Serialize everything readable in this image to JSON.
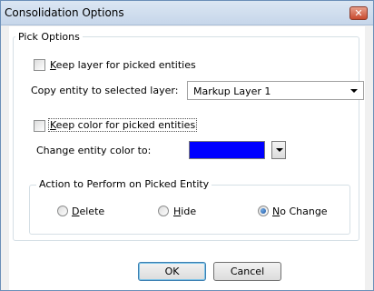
{
  "window": {
    "title": "Consolidation Options",
    "close_glyph": "✕"
  },
  "pick_options": {
    "legend": "Pick Options",
    "keep_layer": {
      "prefix": "",
      "accel": "K",
      "rest": "eep layer for picked entities",
      "checked": false
    },
    "copy_layer_label": "Copy entity to selected layer:",
    "layer_select": {
      "value": "Markup Layer 1"
    },
    "keep_color": {
      "prefix": "",
      "accel": "K",
      "rest": "eep color for picked entities",
      "checked": false
    },
    "change_color_label": "Change entity color to:",
    "color_value": "#0000ff"
  },
  "action": {
    "legend": "Action to Perform on Picked Entity",
    "options": [
      {
        "accel": "D",
        "rest": "elete",
        "checked": false
      },
      {
        "accel": "H",
        "rest": "ide",
        "checked": false
      },
      {
        "accel": "N",
        "rest": "o Change",
        "checked": true
      }
    ]
  },
  "buttons": {
    "ok": "OK",
    "cancel": "Cancel"
  }
}
